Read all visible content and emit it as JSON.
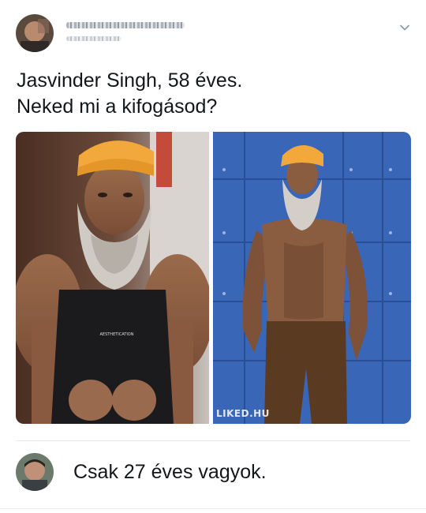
{
  "tweet": {
    "text_line1": "Jasvinder Singh, 58 éves.",
    "text_line2": "Neked mi a kifogásod?"
  },
  "media": {
    "watermark": "LIKED.HU",
    "shirt_print": "AESTHETICATION"
  },
  "reply": {
    "text": "Csak 27 éves vagyok."
  },
  "icons": {
    "menu": "chevron-down-icon"
  },
  "colors": {
    "text": "#14171a",
    "divider": "#e6ecf0",
    "turban": "#f2a83a",
    "lockers": "#3a66b8"
  }
}
